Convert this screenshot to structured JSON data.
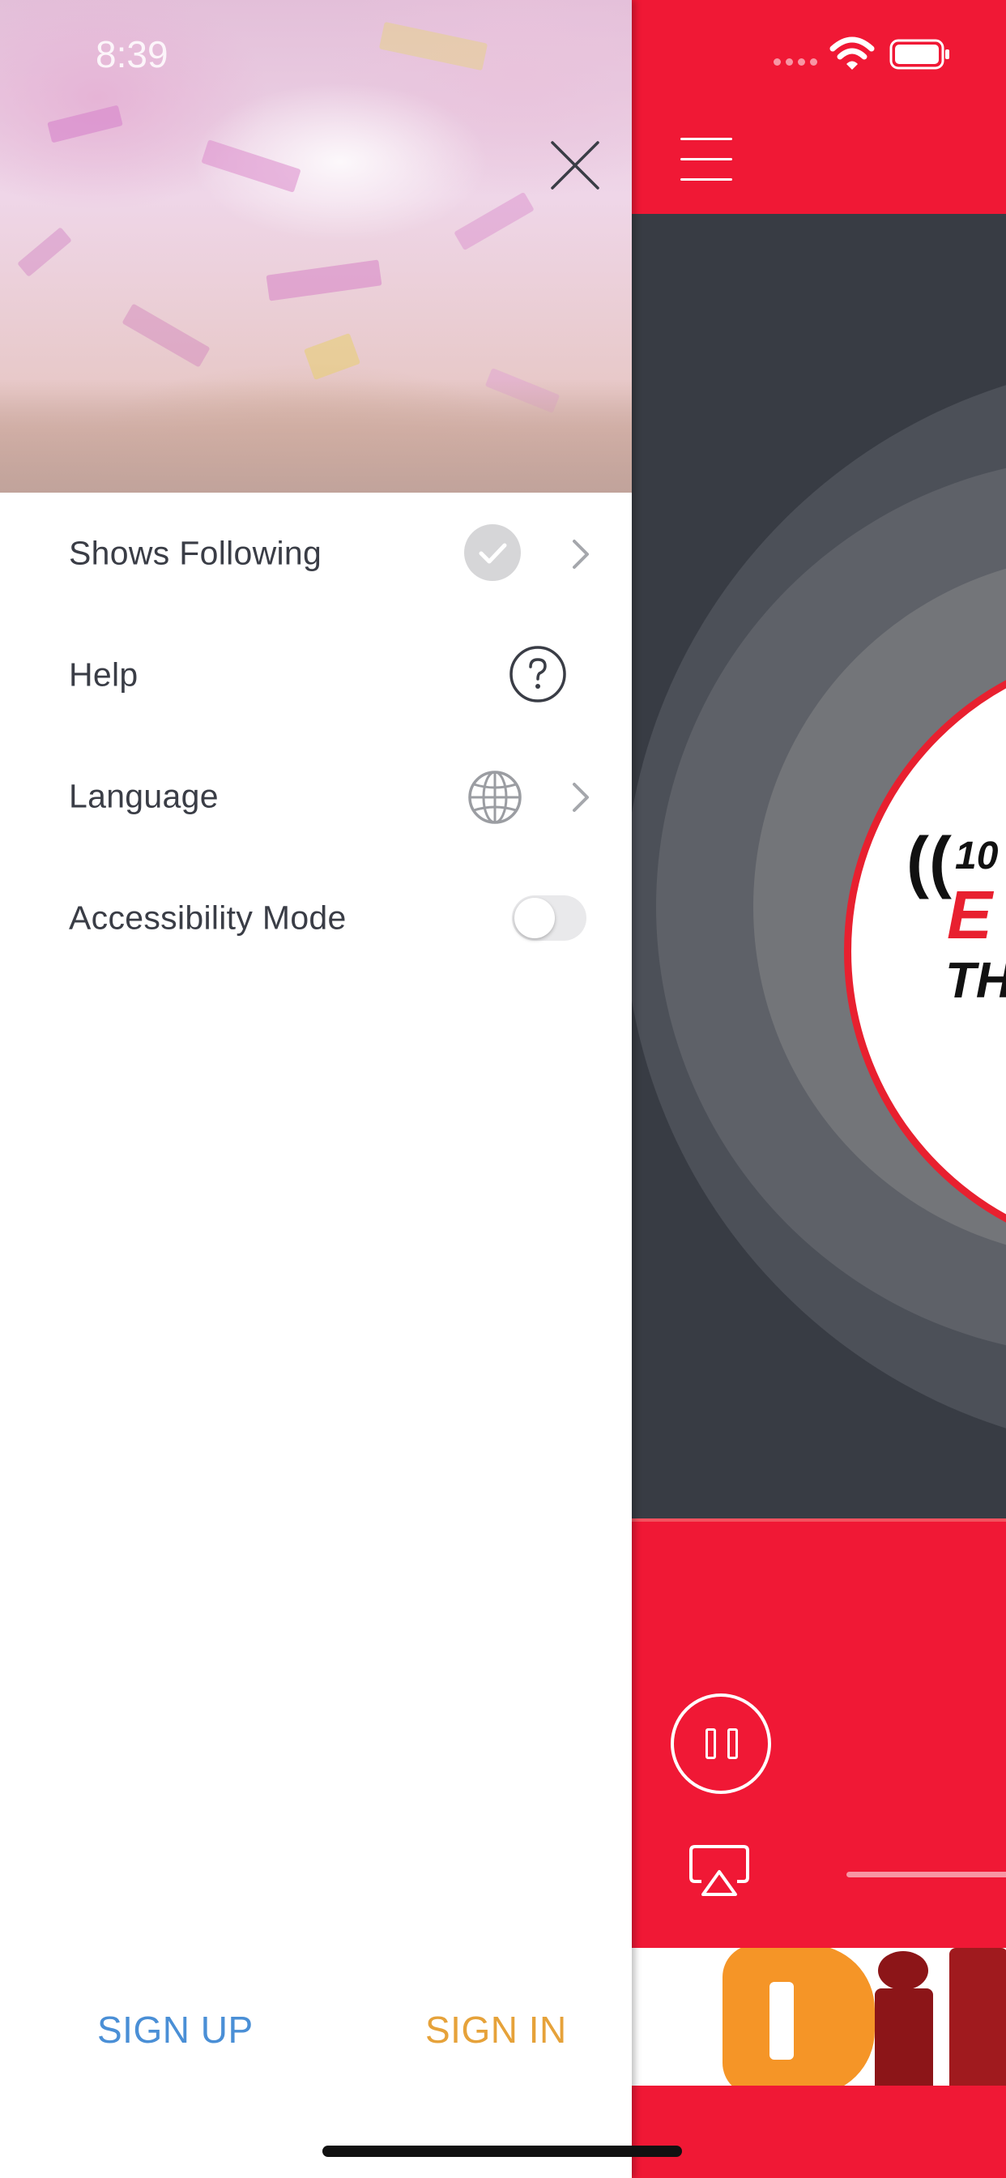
{
  "status_bar": {
    "time": "8:39"
  },
  "drawer": {
    "menu_items": [
      {
        "label": "Shows Following",
        "icon": "checkmark-circle-icon",
        "has_chevron": true
      },
      {
        "label": "Help",
        "icon": "question-circle-icon",
        "has_chevron": false
      },
      {
        "label": "Language",
        "icon": "globe-icon",
        "has_chevron": true
      },
      {
        "label": "Accessibility Mode",
        "icon": "toggle-switch",
        "has_chevron": false
      }
    ],
    "accessibility_mode_enabled": false,
    "sign_up_label": "SIGN UP",
    "sign_in_label": "SIGN IN"
  },
  "player": {
    "station_logo_fragments": {
      "number": "10",
      "red": "E",
      "bottom": "TH"
    }
  },
  "colors": {
    "player_accent": "#f01835",
    "sign_up": "#4a8fd6",
    "sign_in": "#e6a23a",
    "menu_text": "#3a3d46",
    "artwork_bg": "#383c44"
  }
}
